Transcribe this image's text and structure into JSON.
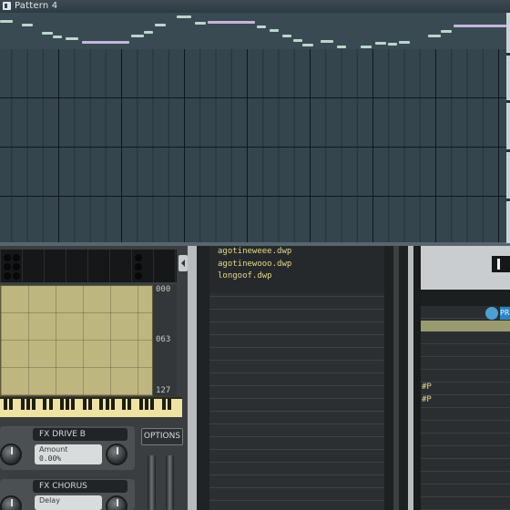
{
  "piano_roll": {
    "title": "Pattern 4",
    "note_color": "#b9d7ca",
    "long_note_color": "#c4b6dc"
  },
  "plugin": {
    "scale_labels": [
      "000",
      "063",
      "127"
    ],
    "fx_drive": {
      "title": "FX DRIVE B",
      "param_label": "Amount",
      "param_value": "0.00%"
    },
    "fx_chorus": {
      "title": "FX CHORUS",
      "param_label": "Delay"
    },
    "options_label": "OPTIONS"
  },
  "browser": {
    "files": [
      "agotineweee.dwp",
      "agotinewooo.dwp",
      "longoof.dwp"
    ]
  },
  "right_panel": {
    "tag_label": "PR",
    "hash_labels": [
      "#P",
      "#P"
    ]
  }
}
